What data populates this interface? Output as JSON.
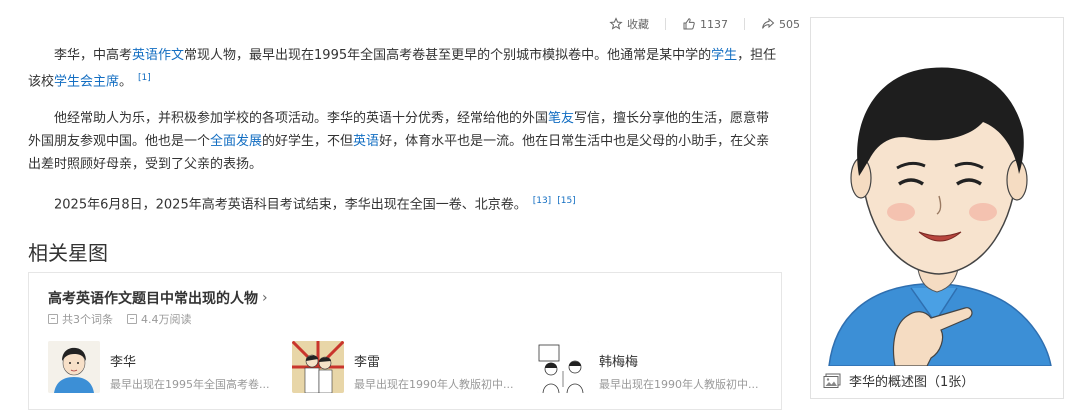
{
  "toolbar": {
    "collect_label": "收藏",
    "like_count": "1137",
    "share_count": "505"
  },
  "article": {
    "p1": {
      "s1": "李华，中高考",
      "l1": "英语作文",
      "s2": "常现人物，最早出现在1995年全国高考卷甚至更早的个别城市模拟卷中。他通常是某中学的",
      "l2": "学生",
      "s3": "，担任该校",
      "l3": "学生会主席",
      "s4": "。",
      "ref1": "[1]"
    },
    "p2": {
      "s1": "他经常助人为乐，并积极参加学校的各项活动。李华的英语十分优秀，经常给他的外国",
      "l1": "笔友",
      "s2": "写信，擅长分享他的生活，愿意带外国朋友参观中国。他也是一个",
      "l2": "全面发展",
      "s3": "的好学生，不但",
      "l3": "英语",
      "s4": "好，体育水平也是一流。他在日常生活中也是父母的小助手，在父亲出差时照顾好母亲，受到了父亲的表扬。"
    },
    "p3": {
      "s1": "2025年6月8日，2025年高考英语科目考试结束，李华出现在全国一卷、北京卷。",
      "ref1": "[13]",
      "ref2": "[15]"
    }
  },
  "related": {
    "section_title": "相关星图",
    "card_title": "高考英语作文题目中常出现的人物",
    "chevron": "›",
    "meta_entries": "共3个词条",
    "meta_reads": "4.4万阅读",
    "persons": [
      {
        "name": "李华",
        "desc": "最早出现在1995年全国高考卷..."
      },
      {
        "name": "李雷",
        "desc": "最早出现在1990年人教版初中..."
      },
      {
        "name": "韩梅梅",
        "desc": "最早出现在1990年人教版初中..."
      }
    ]
  },
  "image_panel": {
    "caption": "李华的概述图（1张）"
  },
  "icons": {
    "collect": "star-icon",
    "like": "thumbs-up-icon",
    "share": "share-arrow-icon",
    "caption": "image-gallery-icon"
  },
  "colors": {
    "link": "#136ec2",
    "text": "#333333",
    "muted": "#999999",
    "shirt": "#3c8fd6"
  }
}
